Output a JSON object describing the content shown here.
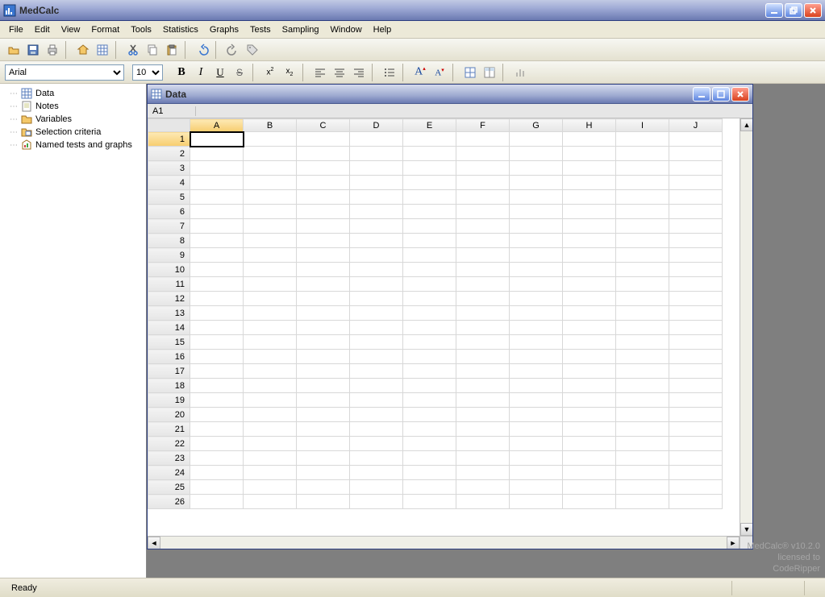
{
  "app": {
    "title": "MedCalc"
  },
  "menus": [
    "File",
    "Edit",
    "View",
    "Format",
    "Tools",
    "Statistics",
    "Graphs",
    "Tests",
    "Sampling",
    "Window",
    "Help"
  ],
  "format": {
    "font_name": "Arial",
    "font_size": "10"
  },
  "tree": {
    "items": [
      {
        "label": "Data",
        "icon": "grid"
      },
      {
        "label": "Notes",
        "icon": "note"
      },
      {
        "label": "Variables",
        "icon": "folder"
      },
      {
        "label": "Selection criteria",
        "icon": "criteria"
      },
      {
        "label": "Named tests and graphs",
        "icon": "chart"
      }
    ]
  },
  "child": {
    "title": "Data",
    "cellref": "A1"
  },
  "columns": [
    "A",
    "B",
    "C",
    "D",
    "E",
    "F",
    "G",
    "H",
    "I",
    "J"
  ],
  "rows": [
    "1",
    "2",
    "3",
    "4",
    "5",
    "6",
    "7",
    "8",
    "9",
    "10",
    "11",
    "12",
    "13",
    "14",
    "15",
    "16",
    "17",
    "18",
    "19",
    "20",
    "21",
    "22",
    "23",
    "24",
    "25",
    "26"
  ],
  "selected": {
    "row": 0,
    "col": 0
  },
  "status": {
    "text": "Ready"
  },
  "watermark": {
    "line1": "MedCalc® v10.2.0",
    "line2": "licensed to",
    "line3": "CodeRipper"
  }
}
